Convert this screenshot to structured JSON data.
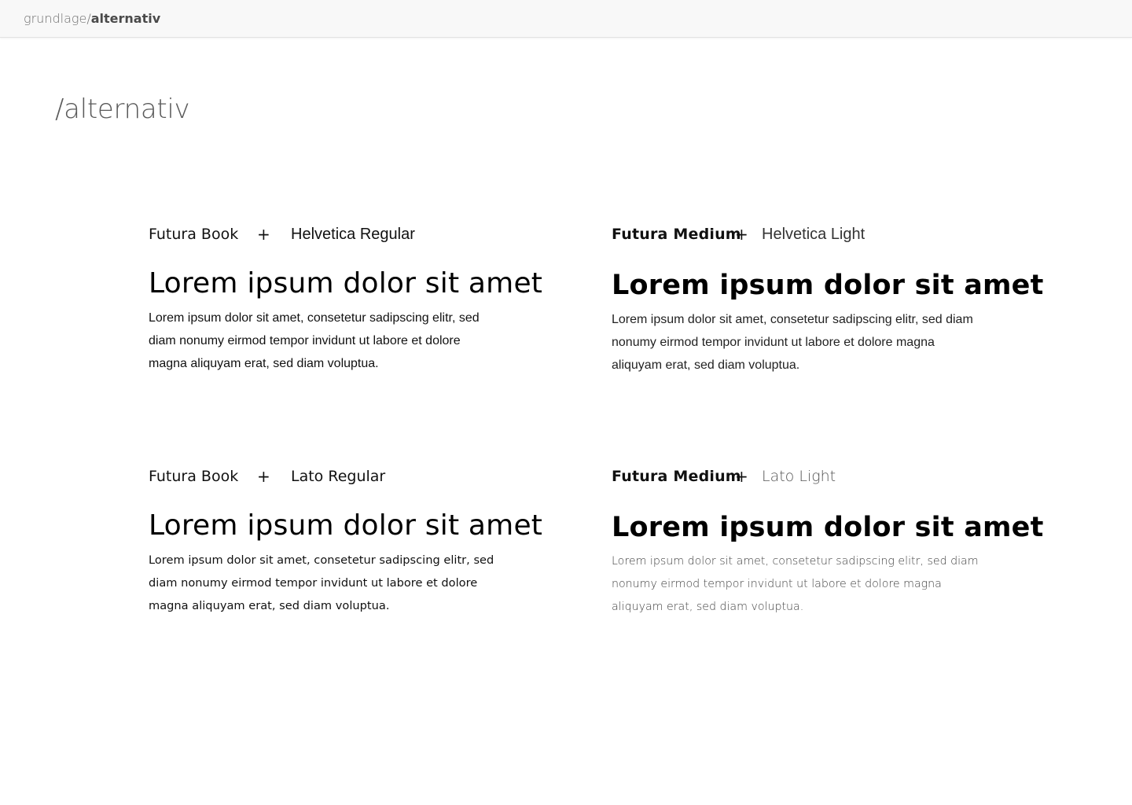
{
  "header": {
    "breadcrumb_parent": "grundlage/",
    "breadcrumb_current": "alternativ"
  },
  "page": {
    "title": "/alternativ"
  },
  "pairs": [
    {
      "heading_font": "Futura Book",
      "plus": "+",
      "body_font": "Helvetica Regular",
      "sample_heading": "Lorem ipsum dolor sit amet",
      "sample_body": "Lorem ipsum dolor sit amet, consetetur sadipscing elitr, sed diam nonumy eirmod tempor invidunt ut labore et dolore magna aliquyam erat, sed diam voluptua."
    },
    {
      "heading_font": "Futura Medium",
      "plus": "+",
      "body_font": "Helvetica Light",
      "sample_heading": "Lorem ipsum dolor sit amet",
      "sample_body": "Lorem ipsum dolor sit amet, consetetur sadipscing elitr, sed diam nonumy eirmod tempor invidunt ut labore et dolore magna aliquyam erat, sed diam voluptua."
    },
    {
      "heading_font": "Futura Book",
      "plus": "+",
      "body_font": "Lato Regular",
      "sample_heading": "Lorem ipsum dolor sit amet",
      "sample_body": "Lorem ipsum dolor sit amet, consetetur sadipscing elitr, sed diam nonumy eirmod tempor invidunt ut labore et dolore magna aliquyam erat, sed diam voluptua."
    },
    {
      "heading_font": "Futura Medium",
      "plus": "+",
      "body_font": "Lato Light",
      "sample_heading": "Lorem ipsum dolor sit amet",
      "sample_body": "Lorem ipsum dolor sit amet, consetetur sadipscing elitr, sed diam nonumy eirmod tempor invidunt ut labore et dolore magna aliquyam erat, sed diam voluptua."
    }
  ],
  "colors": {
    "topbar_background": "#f8f8f8",
    "topbar_border": "#e2e2e2",
    "title_text": "#5a5a5a",
    "body_text": "#111111"
  }
}
